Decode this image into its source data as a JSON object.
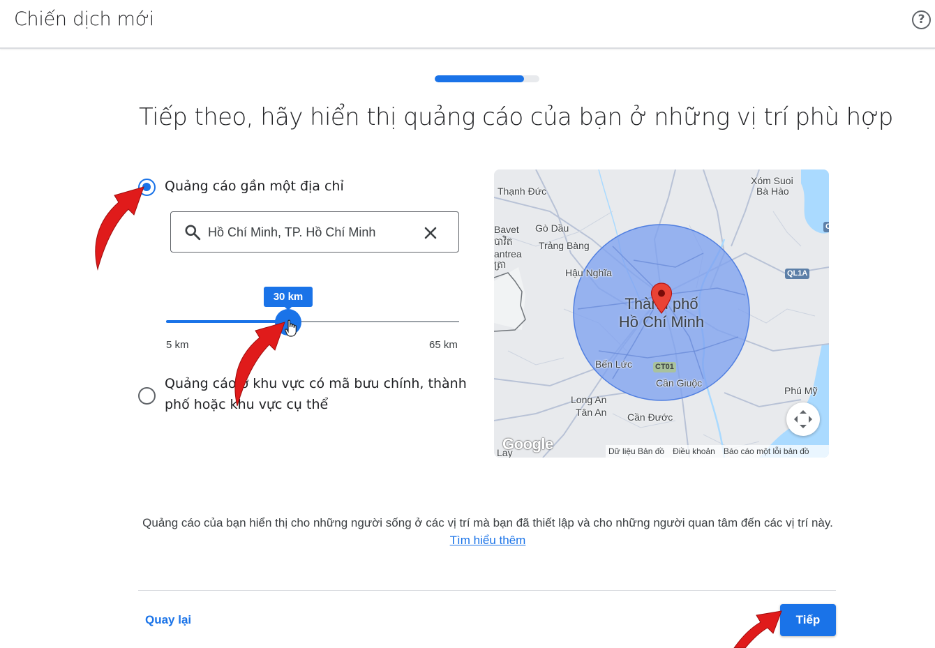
{
  "header": {
    "title": "Chiến dịch mới",
    "help_icon": "help-circle-icon"
  },
  "progress": {
    "fraction": 0.85
  },
  "heading": "Tiếp theo, hãy hiển thị quảng cáo của bạn ở những vị trí phù hợp",
  "options": {
    "near_address": {
      "label": "Quảng cáo gần một địa chỉ",
      "selected": true
    },
    "area": {
      "label_line1": "Quảng cáo ở khu vực có mã bưu chính, thành",
      "label_line2": "phố hoặc khu vực cụ thể",
      "selected": false
    }
  },
  "search": {
    "value": "Hồ Chí Minh, TP. Hồ Chí Minh",
    "search_icon": "search-icon",
    "clear_icon": "close-icon"
  },
  "radius_slider": {
    "value_label": "30 km",
    "value": 30,
    "min_label": "5 km",
    "max_label": "65 km",
    "min": 5,
    "max": 65
  },
  "map": {
    "city_line1": "Thành phố",
    "city_line2": "Hồ Chí Minh",
    "places": {
      "thanh_duc": "Thạnh Đức",
      "xom_suoi": "Xóm Suoi",
      "ba_hao": "Bà Hào",
      "bavet": "Bavet",
      "bavet_kh": "បាវិត",
      "antrea": "antrea",
      "antrea_kh": "ត្រា",
      "go_dau": "Gò Dầu",
      "trang_bang": "Trảng Bàng",
      "hau_nghia": "Hậu Nghĩa",
      "ben_luc": "Bến Lức",
      "can_giuoc": "Cần Giuộc",
      "phu_my": "Phú Mỹ",
      "long_an": "Long An",
      "tan_an": "Tân An",
      "can_duoc": "Cần Đước",
      "lay": "Lay"
    },
    "road_badges": {
      "ql1a": "QL1A",
      "ct01": "CT01",
      "edge": "C"
    },
    "expand_icon": "fullscreen-expand-icon",
    "pin_icon": "map-pin-icon",
    "logo": "Google",
    "footer": {
      "data": "Dữ liệu Bản đồ",
      "terms": "Điều khoản",
      "report": "Báo cáo một lỗi bản đồ"
    },
    "colors": {
      "radius_fill": "#7fa2ef",
      "radius_stroke": "#4f7ee0",
      "pin": "#ea4335",
      "water": "#aadaff",
      "land": "#e8eaed"
    }
  },
  "note": {
    "text": "Quảng cáo của bạn hiển thị cho những người sống ở các vị trí mà bạn đã thiết lập và cho những người quan tâm đến các vị trí này.",
    "link": "Tìm hiểu thêm"
  },
  "footer": {
    "back_label": "Quay lại",
    "next_label": "Tiếp"
  },
  "colors": {
    "accent": "#1a73e8",
    "annotation_arrow": "#e01b1b"
  }
}
